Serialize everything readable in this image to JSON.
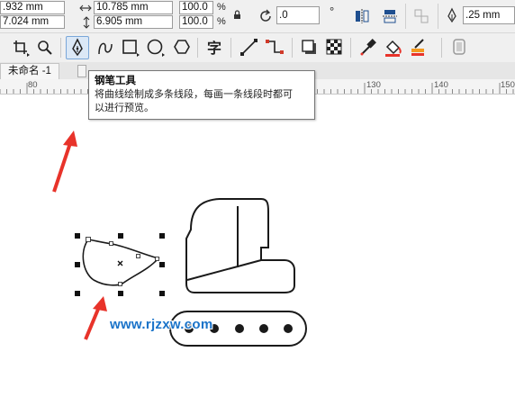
{
  "propbar": {
    "x_value": ".932 mm",
    "y_value": "7.024 mm",
    "width_value": "10.785 mm",
    "height_value": "6.905 mm",
    "scale_x": "100.0",
    "scale_y": "100.0",
    "percent": "%",
    "rotation": ".0",
    "degree": "°",
    "outline_width": ".25 mm"
  },
  "tab": {
    "label": "未命名 -1"
  },
  "ruler": {
    "ticks": [
      "80",
      "130",
      "140",
      "150"
    ]
  },
  "tooltip": {
    "title": "钢笔工具",
    "line1": "将曲线绘制成多条线段，每画一条线段时都可",
    "line2": "以进行预览。"
  },
  "watermark": "www.rjzxw.com",
  "colors": {
    "accent_red": "#e8332a",
    "tool_highlight": "#dbe8f6",
    "watermark": "#1a73c9"
  }
}
